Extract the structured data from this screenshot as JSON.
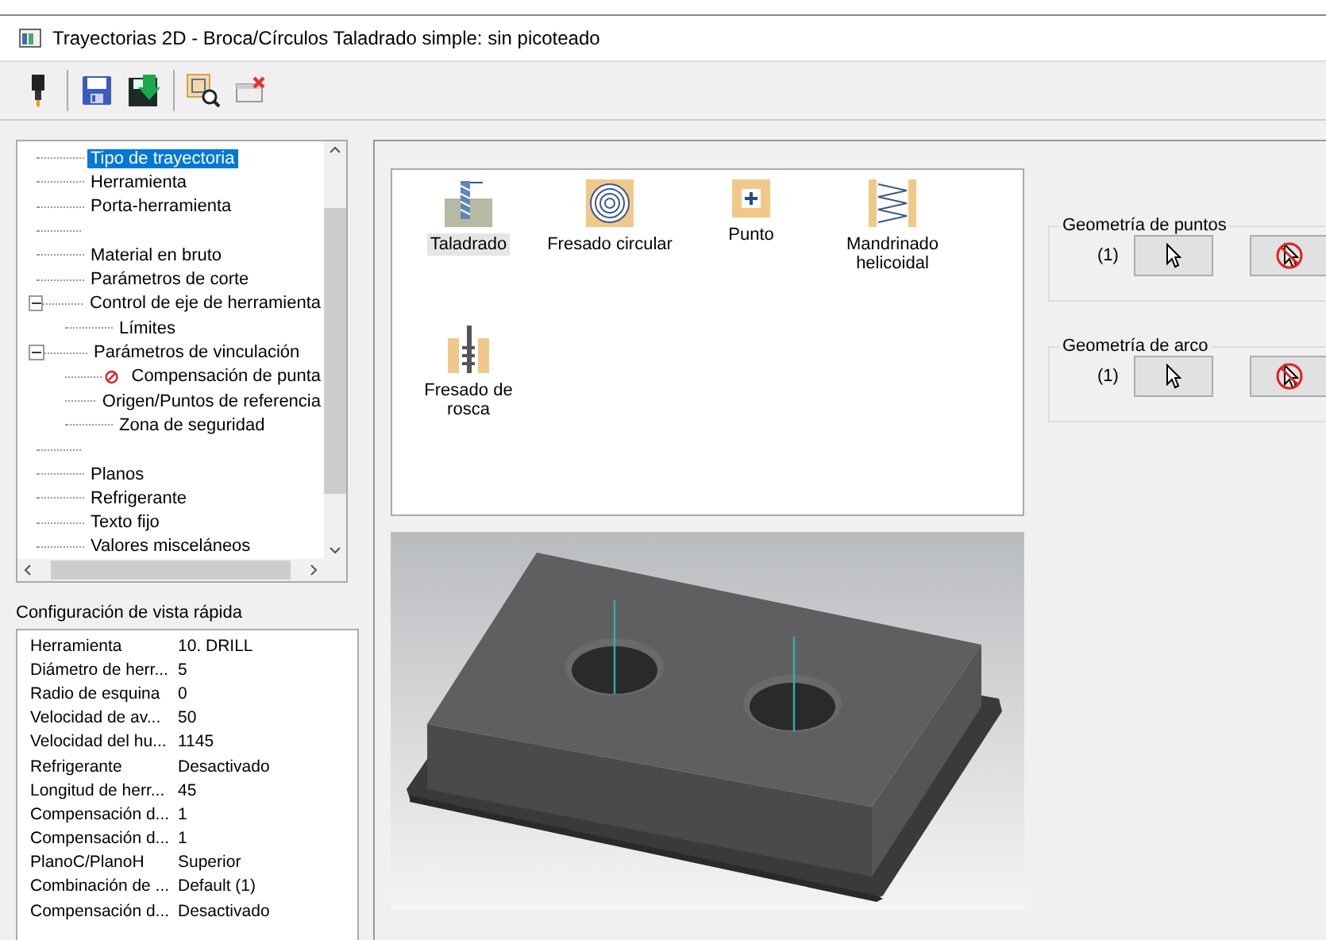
{
  "window": {
    "title": "Trayectorias 2D - Broca/Círculos Taladrado simple: sin picoteado"
  },
  "toolbar": [
    {
      "kind": "tool"
    },
    {
      "kind": "separator"
    },
    {
      "kind": "save"
    },
    {
      "kind": "save-as"
    },
    {
      "kind": "separator"
    },
    {
      "kind": "preview"
    },
    {
      "kind": "close"
    }
  ],
  "tree": {
    "items": [
      {
        "label": "Tipo de trayectoria",
        "selected": true
      },
      {
        "label": "Herramienta",
        "selected": false
      },
      {
        "label": "Porta-herramienta",
        "selected": false
      },
      {
        "kind": "blank"
      },
      {
        "label": "Material en bruto",
        "selected": false
      },
      {
        "label": "Parámetros de corte",
        "selected": false
      },
      {
        "label": "Control de eje de herramienta",
        "selected": false,
        "expanded": true,
        "children": [
          {
            "label": "Límites",
            "selected": false
          }
        ]
      },
      {
        "label": "Parámetros de vinculación",
        "selected": false,
        "expanded": true,
        "children": [
          {
            "label": "Compensación de punta",
            "selected": false,
            "error": true
          },
          {
            "label": "Origen/Puntos de referencia",
            "selected": false
          },
          {
            "label": "Zona de seguridad",
            "selected": false
          }
        ]
      },
      {
        "kind": "blank"
      },
      {
        "label": "Planos",
        "selected": false
      },
      {
        "label": "Refrigerante",
        "selected": false
      },
      {
        "label": "Texto fijo",
        "selected": false
      },
      {
        "label": "Valores misceláneos",
        "selected": false
      }
    ]
  },
  "quick_view": {
    "title": "Configuración de vista rápida",
    "rows": [
      {
        "name": "Herramienta",
        "value": "10. DRILL"
      },
      {
        "name": "Diámetro de herr...",
        "value": "5"
      },
      {
        "name": "Radio de esquina",
        "value": "0"
      },
      {
        "name": "Velocidad de av...",
        "value": "50"
      },
      {
        "name": "Velocidad del hu...",
        "value": "1145"
      },
      {
        "name": "Refrigerante",
        "value": "Desactivado"
      },
      {
        "name": "Longitud de herr...",
        "value": "45"
      },
      {
        "name": "Compensación d...",
        "value": "1"
      },
      {
        "name": "Compensación d...",
        "value": "1"
      },
      {
        "name": "PlanoC/PlanoH",
        "value": "Superior"
      },
      {
        "name": "Combinación de ...",
        "value": "Default (1)"
      },
      {
        "name": "Compensación d...",
        "value": "Desactivado"
      }
    ]
  },
  "operations": [
    {
      "kind": "drill",
      "label": "Taladrado",
      "selected": true
    },
    {
      "kind": "circle",
      "label": "Fresado circular",
      "selected": false
    },
    {
      "kind": "point",
      "label": "Punto",
      "selected": false
    },
    {
      "kind": "helix",
      "label": "Mandrinado helicoidal",
      "selected": false
    },
    {
      "kind": "thread",
      "label": "Fresado de rosca",
      "selected": false
    }
  ],
  "geometry": [
    {
      "title": "Geometría de puntos",
      "count": "(1)"
    },
    {
      "title": "Geometría de arco",
      "count": "(1)"
    }
  ]
}
